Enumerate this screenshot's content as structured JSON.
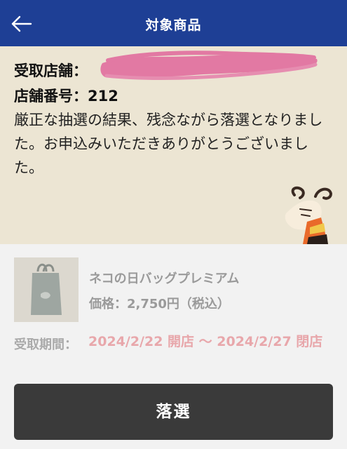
{
  "header": {
    "title": "対象商品",
    "back_icon": "arrow-left-icon"
  },
  "result": {
    "store_label": "受取店舗：",
    "store_name_redacted": true,
    "store_number_label": "店舗番号：",
    "store_number": "212",
    "message": "厳正な抽選の結果、残念ながら落選となりました。お申込みいただきありがとうございました。"
  },
  "product": {
    "name": "ネコの日バッグプレミアム",
    "price_label": "価格：",
    "price": "2,750円（税込）"
  },
  "pickup": {
    "label": "受取期間：",
    "period": "2024/2/22 開店 〜 2024/2/27 閉店"
  },
  "status_button": {
    "label": "落選"
  },
  "colors": {
    "header_bg": "#1e3f95",
    "panel_bg": "#ece5d3",
    "period_text": "#e8a7ab",
    "button_bg": "#3a3a3a",
    "redaction": "#e279a3"
  }
}
